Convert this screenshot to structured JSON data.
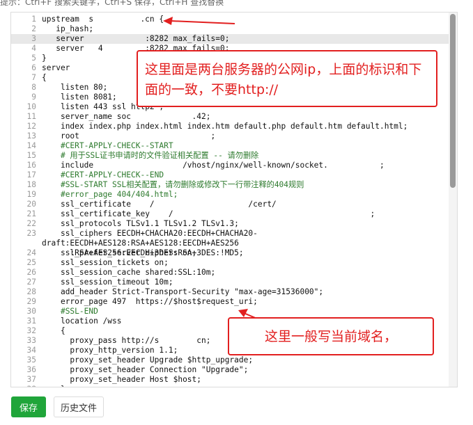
{
  "top_hint": "提示：Ctrl+F 搜索关键字，Ctrl+S 保存，Ctrl+H 查找替换",
  "code_lines": [
    {
      "n": "1",
      "t": "upstream  s          .cn {"
    },
    {
      "n": "2",
      "t": "   ip_hash;"
    },
    {
      "n": "3",
      "t": "   server             :8282 max_fails=0;"
    },
    {
      "n": "4",
      "t": "   server   4         :8282 max_fails=0;"
    },
    {
      "n": "5",
      "t": "}"
    },
    {
      "n": "6",
      "t": "server"
    },
    {
      "n": "7",
      "t": "{"
    },
    {
      "n": "8",
      "t": "    listen 80;"
    },
    {
      "n": "9",
      "t": "    listen 8081;"
    },
    {
      "n": "10",
      "t": "    listen 443 ssl http2 ;"
    },
    {
      "n": "11",
      "t": "    server_name soc             .42;"
    },
    {
      "n": "12",
      "t": "    index index.php index.html index.htm default.php default.htm default.html;"
    },
    {
      "n": "13",
      "t": "    root                            ;"
    },
    {
      "n": "14",
      "t": "    #CERT-APPLY-CHECK--START"
    },
    {
      "n": "15",
      "t": "    # 用于SSL证书申请时的文件验证相关配置 -- 请勿删除"
    },
    {
      "n": "16",
      "t": "    include                   /vhost/nginx/well-known/socket.           ;"
    },
    {
      "n": "17",
      "t": "    #CERT-APPLY-CHECK--END"
    },
    {
      "n": "18",
      "t": "    #SSL-START SSL相关配置，请勿删除或修改下一行带注释的404规则"
    },
    {
      "n": "19",
      "t": "    #error_page 404/404.html;"
    },
    {
      "n": "20",
      "t": "    ssl_certificate    /                    /cert/             "
    },
    {
      "n": "21",
      "t": "    ssl_certificate_key    /                                          ;"
    },
    {
      "n": "22",
      "t": "    ssl_protocols TLSv1.1 TLSv1.2 TLSv1.3;"
    },
    {
      "n": "23",
      "t": "    ssl_ciphers EECDH+CHACHA20:EECDH+CHACHA20-draft:EECDH+AES128:RSA+AES128:EECDH+AES256\n      :RSA+AES256:EECDH+3DES:RSA+3DES:!MD5;"
    },
    {
      "n": "24",
      "t": "    ssl_prefer_server_ciphers on;"
    },
    {
      "n": "25",
      "t": "    ssl_session_tickets on;"
    },
    {
      "n": "26",
      "t": "    ssl_session_cache shared:SSL:10m;"
    },
    {
      "n": "27",
      "t": "    ssl_session_timeout 10m;"
    },
    {
      "n": "28",
      "t": "    add_header Strict-Transport-Security \"max-age=31536000\";"
    },
    {
      "n": "29",
      "t": "    error_page 497  https://$host$request_uri;"
    },
    {
      "n": "30",
      "t": "    #SSL-END"
    },
    {
      "n": "31",
      "t": "    location /wss"
    },
    {
      "n": "32",
      "t": "    {"
    },
    {
      "n": "33",
      "t": "      proxy_pass http://s        cn;"
    },
    {
      "n": "34",
      "t": "      proxy_http_version 1.1;"
    },
    {
      "n": "35",
      "t": "      proxy_set_header Upgrade $http_upgrade;"
    },
    {
      "n": "36",
      "t": "      proxy_set_header Connection \"Upgrade\";"
    },
    {
      "n": "37",
      "t": "      proxy_set_header Host $host;"
    },
    {
      "n": "38",
      "t": "    }"
    }
  ],
  "annotation_1": "这里面是两台服务器的公网ip，上面的标识和下面的一致，不要http://",
  "annotation_2": "这里一般写当前域名，",
  "buttons": {
    "save": "保存",
    "history": "历史文件"
  },
  "colors": {
    "save_green": "#20a53a",
    "annotation_red": "#e21f1f",
    "keyword_blue": "#1c3ba8",
    "comment_green": "#2d7a2d"
  }
}
